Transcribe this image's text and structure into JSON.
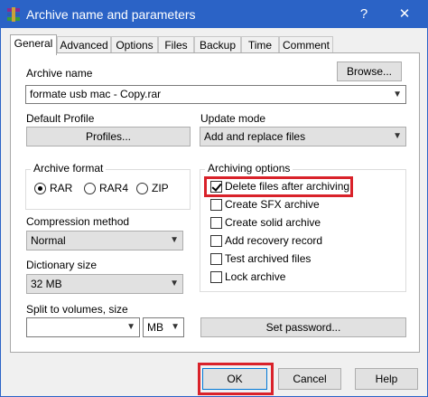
{
  "window": {
    "title": "Archive name and parameters",
    "help_glyph": "?",
    "close_glyph": "✕"
  },
  "tabs": [
    "General",
    "Advanced",
    "Options",
    "Files",
    "Backup",
    "Time",
    "Comment"
  ],
  "archive_name": {
    "label": "Archive name",
    "browse_label": "Browse...",
    "value": "formate usb mac - Copy.rar"
  },
  "profile": {
    "label": "Default Profile",
    "button_label": "Profiles..."
  },
  "update_mode": {
    "label": "Update mode",
    "value": "Add and replace files"
  },
  "archive_format": {
    "label": "Archive format",
    "options": [
      "RAR",
      "RAR4",
      "ZIP"
    ],
    "selected": "RAR"
  },
  "compression": {
    "label": "Compression method",
    "value": "Normal"
  },
  "dictionary": {
    "label": "Dictionary size",
    "value": "32 MB"
  },
  "split": {
    "label": "Split to volumes, size",
    "value": "",
    "unit": "MB"
  },
  "archiving_options": {
    "label": "Archiving options",
    "items": [
      {
        "label": "Delete files after archiving",
        "checked": true
      },
      {
        "label": "Create SFX archive",
        "checked": false
      },
      {
        "label": "Create solid archive",
        "checked": false
      },
      {
        "label": "Add recovery record",
        "checked": false
      },
      {
        "label": "Test archived files",
        "checked": false
      },
      {
        "label": "Lock archive",
        "checked": false
      }
    ]
  },
  "password_button": "Set password...",
  "footer": {
    "ok": "OK",
    "cancel": "Cancel",
    "help": "Help"
  },
  "colors": {
    "titlebar": "#2b63c6",
    "highlight": "#d9222a"
  }
}
